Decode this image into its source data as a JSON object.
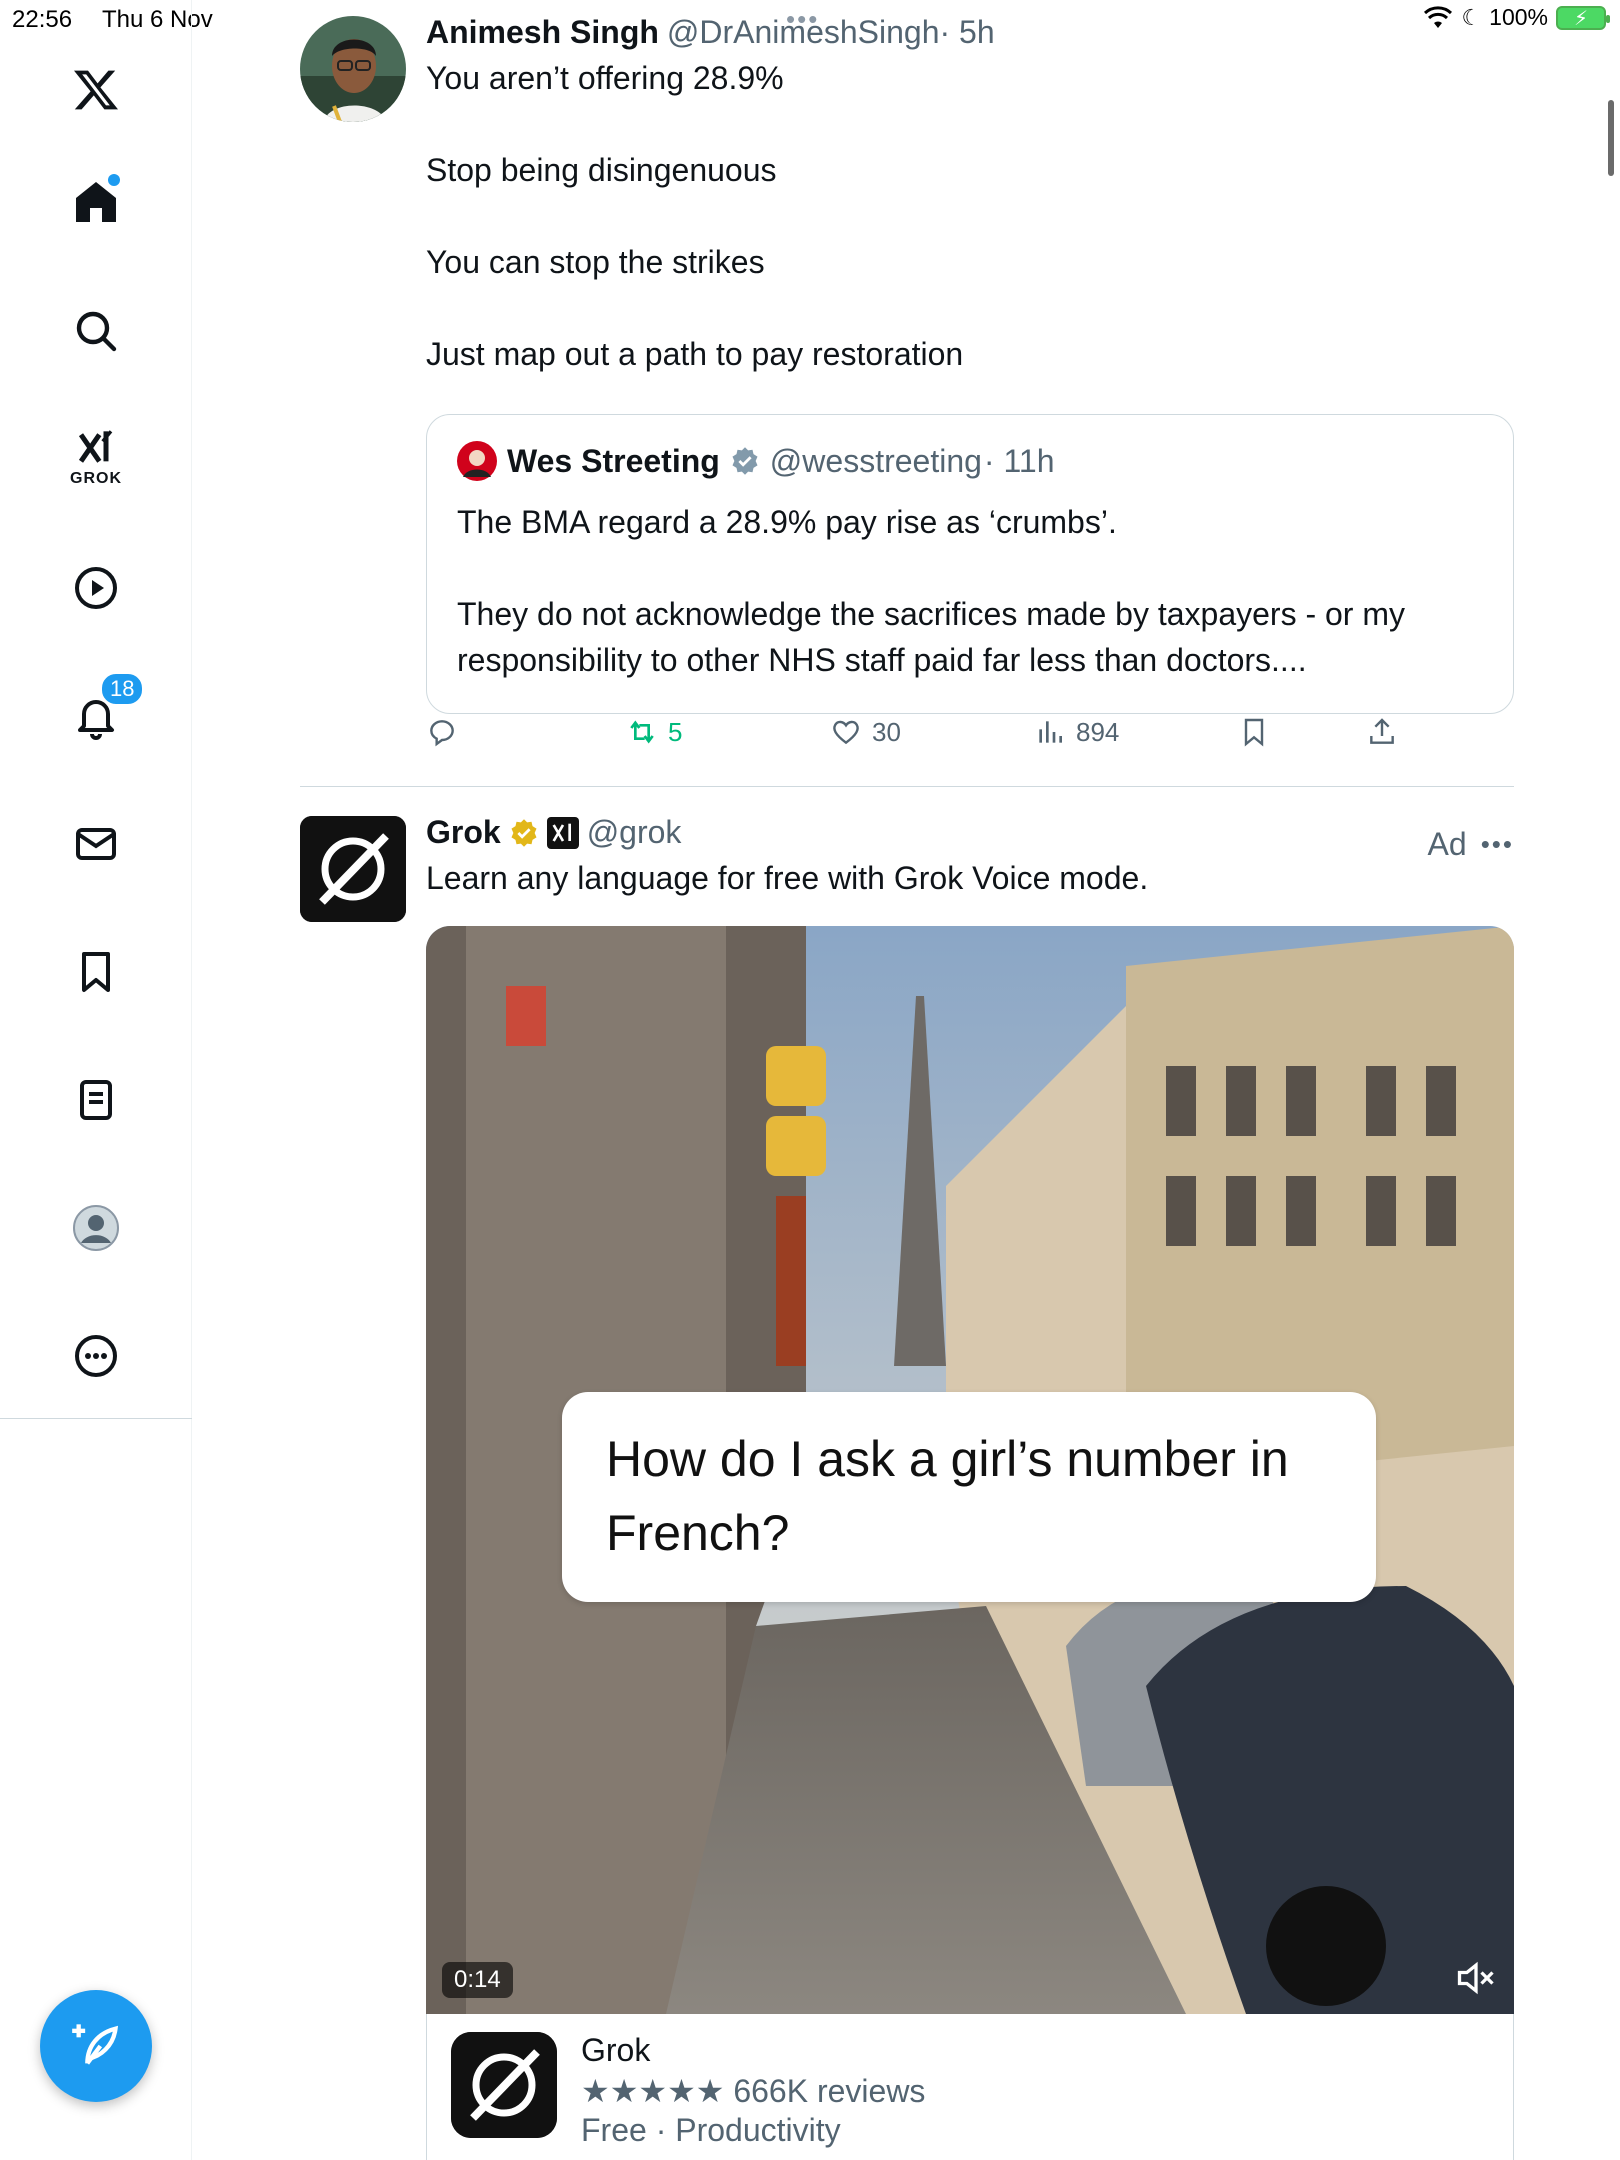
{
  "status_bar": {
    "time": "22:56",
    "date": "Thu 6 Nov",
    "battery": "100%"
  },
  "sidebar": {
    "items": [
      {
        "name": "x-logo"
      },
      {
        "name": "home"
      },
      {
        "name": "search"
      },
      {
        "name": "grok",
        "label": "GROK"
      },
      {
        "name": "video"
      },
      {
        "name": "notifications",
        "badge": "18"
      },
      {
        "name": "messages"
      },
      {
        "name": "bookmarks"
      },
      {
        "name": "lists"
      },
      {
        "name": "profile"
      },
      {
        "name": "more"
      }
    ]
  },
  "tweet1": {
    "name": "Animesh Singh",
    "handle": "@DrAnimeshSingh",
    "time": "· 5h",
    "lines": [
      "You aren’t offering 28.9%",
      "Stop being disingenuous",
      "You can stop the strikes",
      "Just map out a path to pay restoration"
    ],
    "quote": {
      "name": "Wes Streeting",
      "handle": "@wesstreeting",
      "time": "· 11h",
      "para1": "The BMA regard a 28.9% pay rise as ‘crumbs’.",
      "para2": "They do not acknowledge the sacrifices made by taxpayers - or my responsibility to other NHS staff paid far less than doctors...."
    },
    "stats": {
      "retweets": "5",
      "likes": "30",
      "views": "894"
    }
  },
  "tweet2": {
    "name": "Grok",
    "handle": "@grok",
    "ad_label": "Ad",
    "text": "Learn any language for free with Grok Voice mode.",
    "video": {
      "caption": "How do I ask a girl’s number in French?",
      "duration": "0:14"
    },
    "app_card": {
      "name": "Grok",
      "rating": "★★★★★ 666K reviews",
      "meta": "Free · Productivity"
    }
  },
  "colors": {
    "accent": "#1d9bf0",
    "retweet_green": "#00ba7c",
    "muted_text": "#536471",
    "verified_gold": "#e2b719"
  }
}
